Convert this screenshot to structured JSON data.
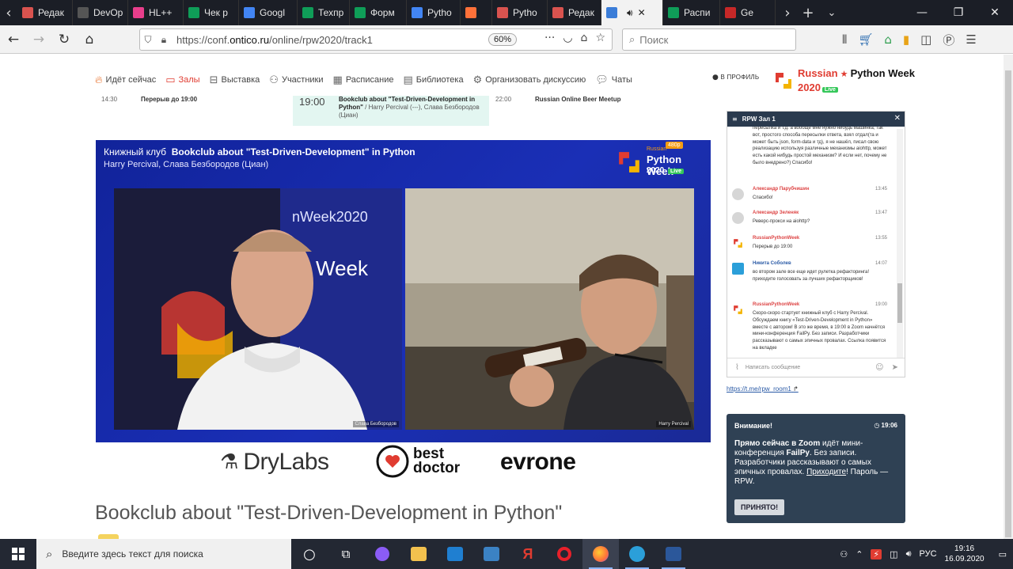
{
  "browser": {
    "tabs": [
      {
        "label": "Редак",
        "color": "#d9534f"
      },
      {
        "label": "DevOp",
        "color": "#555"
      },
      {
        "label": "HL++",
        "color": "#e83e8c"
      },
      {
        "label": "Чек р",
        "color": "#0f9d58"
      },
      {
        "label": "Googl",
        "color": "#4285f4"
      },
      {
        "label": "Техпр",
        "color": "#0f9d58"
      },
      {
        "label": "Форм",
        "color": "#0f9d58"
      },
      {
        "label": "Pytho",
        "color": "#4285f4"
      },
      {
        "label": "",
        "color": "#ff7139"
      },
      {
        "label": "Pytho",
        "color": "#d9534f"
      },
      {
        "label": "Редак",
        "color": "#d9534f"
      },
      {
        "label": "",
        "color": "#3b7dd8"
      },
      {
        "label": "Распи",
        "color": "#0f9d58"
      },
      {
        "label": "Ge",
        "color": "#c62828"
      }
    ],
    "url_prefix": "https://conf.",
    "url_domain": "ontico.ru",
    "url_path": "/online/rpw2020/track1",
    "zoom": "60%",
    "search_placeholder": "Поиск"
  },
  "sitenav": {
    "items": [
      "Идёт сейчас",
      "Залы",
      "Выставка",
      "Участники",
      "Расписание",
      "Библиотека",
      "Организовать дискуссию",
      "Чаты"
    ],
    "profile": "В ПРОФИЛЬ",
    "logo_line1": "Russian",
    "logo_line2": "2020",
    "logo_brand": "Python Week",
    "logo_live": "Live"
  },
  "schedule": {
    "left_time": "14:30",
    "left_title": "Перерыв до 19:00",
    "center_time": "19:00",
    "center_title": "Bookclub about \"Test-Driven-Development in Python\"",
    "center_speakers": "/ Harry Percival (---), Слава Безбородов (Циан)",
    "right_time": "22:00",
    "right_title": "Russian Online Beer Meetup"
  },
  "player": {
    "label_prefix": "Книжный клуб",
    "title": "Bookclub about \"Test-Driven-Development\" in Python",
    "subtitle": "Harry Percival, Слава Безбородов (Циан)",
    "resolution": "480p",
    "logo_small": "Russian",
    "logo_brand": "Python Week",
    "logo_year": "2020",
    "logo_live": "Live",
    "name_left": "Слава Безбородов",
    "name_right": "Harry Percival",
    "backdrop_text": "nWeek2020",
    "backdrop_word": "Week"
  },
  "sponsors": [
    "DryLabs",
    "best",
    "doctor",
    "evrone"
  ],
  "page_title": "Bookclub about \"Test-Driven-Development in Python\"",
  "chat": {
    "header": "RPW Зал 1",
    "messages": [
      {
        "name": "",
        "time": "",
        "text": "пересылка и т.д. а вообще мне нужно нибудь машинка, так вот, простого способа пересылки ответа, взял отдал(та и может быть json, form-data и тд), я не нашёл, писал свою реализацию используя различные механизмы aiohttp, может есть какой нибудь простой механизм? И если нет, почему не было внедрено?) Спасибо!"
      },
      {
        "name": "Александр Парубчишин",
        "time": "13:45",
        "text": "Спасибо!"
      },
      {
        "name": "Александр Зеленяк",
        "time": "13:47",
        "text": "Реверс-прокси на aiohttp?"
      },
      {
        "name": "RussianPythonWeek",
        "time": "13:55",
        "text": "Перерыв до 19:00"
      },
      {
        "name": "Никита Соболев",
        "time": "14:07",
        "text": "во втором зале все еще идет рулетка рефакторинга! приходите голосовать за лучших рефакторщиков!"
      },
      {
        "name": "RussianPythonWeek",
        "time": "19:00",
        "text": "Скоро-скоро стартует книжный клуб с Harry Percival. Обсуждаем книгу «Test-Driven-Development in Python» вместе с автором! В это же время, в 19:00 в Zoom начнётся мини-конференция FailPy. Без записи. Разработчики рассказывают о самых эпичных провалах. Ссылка появится на вкладке"
      }
    ],
    "input_placeholder": "Написать сообщение",
    "tg_link": "https://t.me/rpw_room1"
  },
  "alert": {
    "title": "Внимание!",
    "time": "19:06",
    "text_bold": "Прямо сейчас в Zoom",
    "text1": " идёт мини-конференция ",
    "text_failpy": "FailPy",
    "text2": ". Без записи. Разработчики рассказывают о самых эпичных провалах. ",
    "link": "Приходите",
    "text3": "! Пароль — RPW.",
    "button": "ПРИНЯТО!"
  },
  "taskbar": {
    "search_placeholder": "Введите здесь текст для поиска",
    "lang": "РУС",
    "time": "19:16",
    "date": "16.09.2020"
  },
  "colors": {
    "accent_red": "#e03c31",
    "player_blue": "#1a2fb6",
    "alert_bg": "#2f4154"
  }
}
